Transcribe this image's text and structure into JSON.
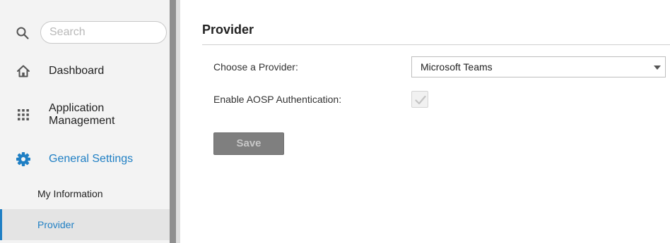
{
  "sidebar": {
    "search": {
      "placeholder": "Search",
      "value": ""
    },
    "items": [
      {
        "label": "Dashboard",
        "icon": "home-icon"
      },
      {
        "label": "Application Management",
        "icon": "apps-grid-icon"
      },
      {
        "label": "General Settings",
        "icon": "gear-icon",
        "active": true
      }
    ],
    "sub_items": [
      {
        "label": "My Information"
      },
      {
        "label": "Provider",
        "active": true
      }
    ]
  },
  "main": {
    "title": "Provider",
    "fields": {
      "provider_label": "Choose a Provider:",
      "provider_value": "Microsoft Teams",
      "aosp_label": "Enable AOSP Authentication:",
      "aosp_checked": true,
      "aosp_disabled": true
    },
    "save_label": "Save"
  },
  "colors": {
    "accent": "#1f7fc4",
    "sidebar_bg": "#f3f3f3",
    "active_sub_bg": "#e4e4e4",
    "save_bg": "#7f7f7f"
  }
}
